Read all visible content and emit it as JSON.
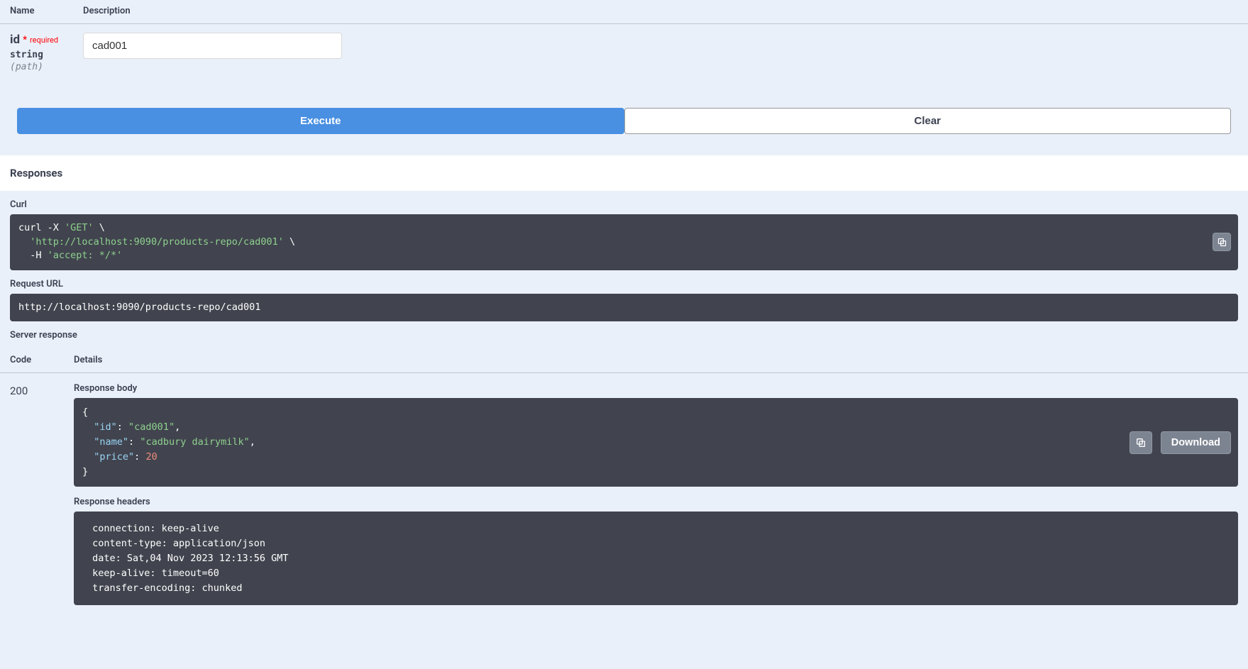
{
  "params_header": {
    "name": "Name",
    "desc": "Description"
  },
  "param": {
    "name": "id",
    "required_label": "required",
    "type": "string",
    "loc": "(path)",
    "value": "cad001"
  },
  "buttons": {
    "execute": "Execute",
    "clear": "Clear"
  },
  "responses_label": "Responses",
  "curl_label": "Curl",
  "curl": {
    "l1a": "curl -X ",
    "l1b": "'GET'",
    "l1c": " \\",
    "l2a": "  ",
    "l2b": "'http://localhost:9090/products-repo/cad001'",
    "l2c": " \\",
    "l3a": "  -H ",
    "l3b": "'accept: */*'"
  },
  "request_url_label": "Request URL",
  "request_url": "http://localhost:9090/products-repo/cad001",
  "server_response_label": "Server response",
  "resp_header": {
    "code": "Code",
    "details": "Details"
  },
  "resp": {
    "code": "200",
    "body_label": "Response body",
    "json": {
      "open": "{",
      "k_id": "\"id\"",
      "v_id": "\"cad001\"",
      "k_name": "\"name\"",
      "v_name": "\"cadbury dairymilk\"",
      "k_price": "\"price\"",
      "v_price": "20",
      "close": "}"
    },
    "download": "Download",
    "headers_label": "Response headers",
    "headers_text": " connection: keep-alive \n content-type: application/json \n date: Sat,04 Nov 2023 12:13:56 GMT \n keep-alive: timeout=60 \n transfer-encoding: chunked "
  }
}
